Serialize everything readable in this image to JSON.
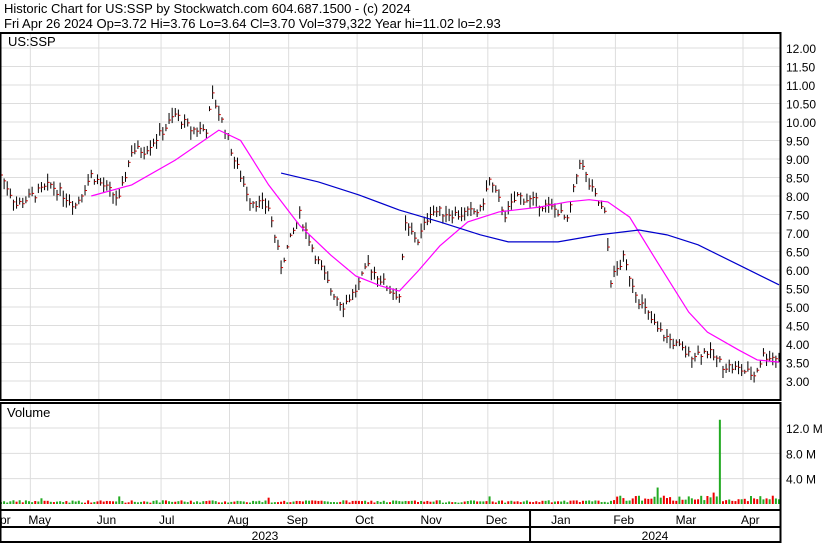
{
  "header": {
    "title": "Historic Chart for US:SSP by Stockwatch.com 604.687.1500 - (c) 2024",
    "quote": "Fri Apr 26 2024  Op=3.72  Hi=3.76  Lo=3.64  Cl=3.70  Vol=379,322  Year hi=11.02  lo=2.93"
  },
  "chart_data": {
    "type": "line",
    "symbol": "US:SSP",
    "volume_label": "Volume",
    "x_unit": "trading day",
    "price_ylim": [
      2.5,
      12.5
    ],
    "price_ticks": [
      "12.00",
      "11.50",
      "11.00",
      "10.50",
      "10.00",
      "9.50",
      "9.00",
      "8.50",
      "8.00",
      "7.50",
      "7.00",
      "6.50",
      "6.00",
      "5.50",
      "5.00",
      "4.50",
      "4.00",
      "3.50",
      "3.00"
    ],
    "volume_ticks": [
      "12.0 M",
      "8.0 M",
      "4.0 M"
    ],
    "volume_ylim": [
      0,
      16
    ],
    "months": [
      {
        "label": "pr",
        "day": 1
      },
      {
        "label": "May",
        "day": 12
      },
      {
        "label": "Jun",
        "day": 34
      },
      {
        "label": "Jul",
        "day": 54
      },
      {
        "label": "Aug",
        "day": 76
      },
      {
        "label": "Sep",
        "day": 95
      },
      {
        "label": "Oct",
        "day": 117
      },
      {
        "label": "Nov",
        "day": 138
      },
      {
        "label": "Dec",
        "day": 159
      },
      {
        "label": "Jan",
        "day": 180
      },
      {
        "label": "Feb",
        "day": 200
      },
      {
        "label": "Mar",
        "day": 220
      },
      {
        "label": "Apr",
        "day": 241
      }
    ],
    "years": [
      {
        "label": "2023"
      },
      {
        "label": "2024"
      }
    ],
    "year_break_day": 170,
    "close": [
      [
        0,
        8.57
      ],
      [
        5,
        7.76
      ],
      [
        16,
        8.3
      ],
      [
        24,
        7.76
      ],
      [
        29,
        8.57
      ],
      [
        38,
        7.9
      ],
      [
        42,
        9.24
      ],
      [
        46,
        9.24
      ],
      [
        51,
        9.65
      ],
      [
        56,
        10.2
      ],
      [
        61,
        9.8
      ],
      [
        66,
        9.8
      ],
      [
        68,
        10.7
      ],
      [
        72,
        9.8
      ],
      [
        75,
        8.97
      ],
      [
        80,
        7.9
      ],
      [
        86,
        7.7
      ],
      [
        90,
        6.13
      ],
      [
        96,
        7.5
      ],
      [
        101,
        6.4
      ],
      [
        106,
        5.46
      ],
      [
        110,
        5.05
      ],
      [
        114,
        5.46
      ],
      [
        118,
        6.13
      ],
      [
        125,
        5.46
      ],
      [
        128,
        5.3
      ],
      [
        130,
        7.2
      ],
      [
        134,
        6.8
      ],
      [
        138,
        7.6
      ],
      [
        147,
        7.5
      ],
      [
        154,
        7.6
      ],
      [
        157,
        8.43
      ],
      [
        162,
        7.5
      ],
      [
        166,
        8.0
      ],
      [
        173,
        7.8
      ],
      [
        179,
        7.6
      ],
      [
        182,
        7.3
      ],
      [
        186,
        8.97
      ],
      [
        189,
        8.3
      ],
      [
        194,
        7.5
      ],
      [
        196,
        5.73
      ],
      [
        200,
        6.3
      ],
      [
        205,
        5.19
      ],
      [
        211,
        4.38
      ],
      [
        221,
        3.7
      ],
      [
        227,
        3.8
      ],
      [
        232,
        3.43
      ],
      [
        238,
        3.3
      ],
      [
        242,
        3.16
      ],
      [
        245,
        3.7
      ],
      [
        250,
        3.62
      ]
    ],
    "ma_short": {
      "color": "#ff00ff",
      "points": [
        [
          29,
          8.0
        ],
        [
          42,
          8.3
        ],
        [
          56,
          8.97
        ],
        [
          70,
          9.78
        ],
        [
          77,
          9.5
        ],
        [
          86,
          8.3
        ],
        [
          96,
          7.2
        ],
        [
          106,
          6.4
        ],
        [
          114,
          5.84
        ],
        [
          122,
          5.57
        ],
        [
          128,
          5.43
        ],
        [
          134,
          5.97
        ],
        [
          141,
          6.65
        ],
        [
          150,
          7.3
        ],
        [
          160,
          7.57
        ],
        [
          173,
          7.7
        ],
        [
          182,
          7.84
        ],
        [
          189,
          7.9
        ],
        [
          195,
          7.84
        ],
        [
          202,
          7.43
        ],
        [
          211,
          6.2
        ],
        [
          221,
          4.86
        ],
        [
          227,
          4.32
        ],
        [
          237,
          3.84
        ],
        [
          243,
          3.57
        ],
        [
          250,
          3.51
        ]
      ]
    },
    "ma_long": {
      "color": "#0000cc",
      "points": [
        [
          90,
          8.62
        ],
        [
          102,
          8.38
        ],
        [
          115,
          8.03
        ],
        [
          128,
          7.62
        ],
        [
          141,
          7.3
        ],
        [
          154,
          6.95
        ],
        [
          163,
          6.76
        ],
        [
          179,
          6.76
        ],
        [
          192,
          6.95
        ],
        [
          205,
          7.08
        ],
        [
          214,
          6.95
        ],
        [
          224,
          6.68
        ],
        [
          237,
          6.14
        ],
        [
          250,
          5.6
        ]
      ]
    },
    "volume_spikes_m": [
      [
        231,
        13.3
      ],
      [
        211,
        2.6
      ],
      [
        229,
        1.8
      ],
      [
        205,
        1.3
      ],
      [
        221,
        1.2
      ],
      [
        86,
        1.0
      ],
      [
        38,
        1.2
      ],
      [
        13,
        0.9
      ],
      [
        157,
        1.2
      ]
    ],
    "volume_base_m": 0.4
  }
}
